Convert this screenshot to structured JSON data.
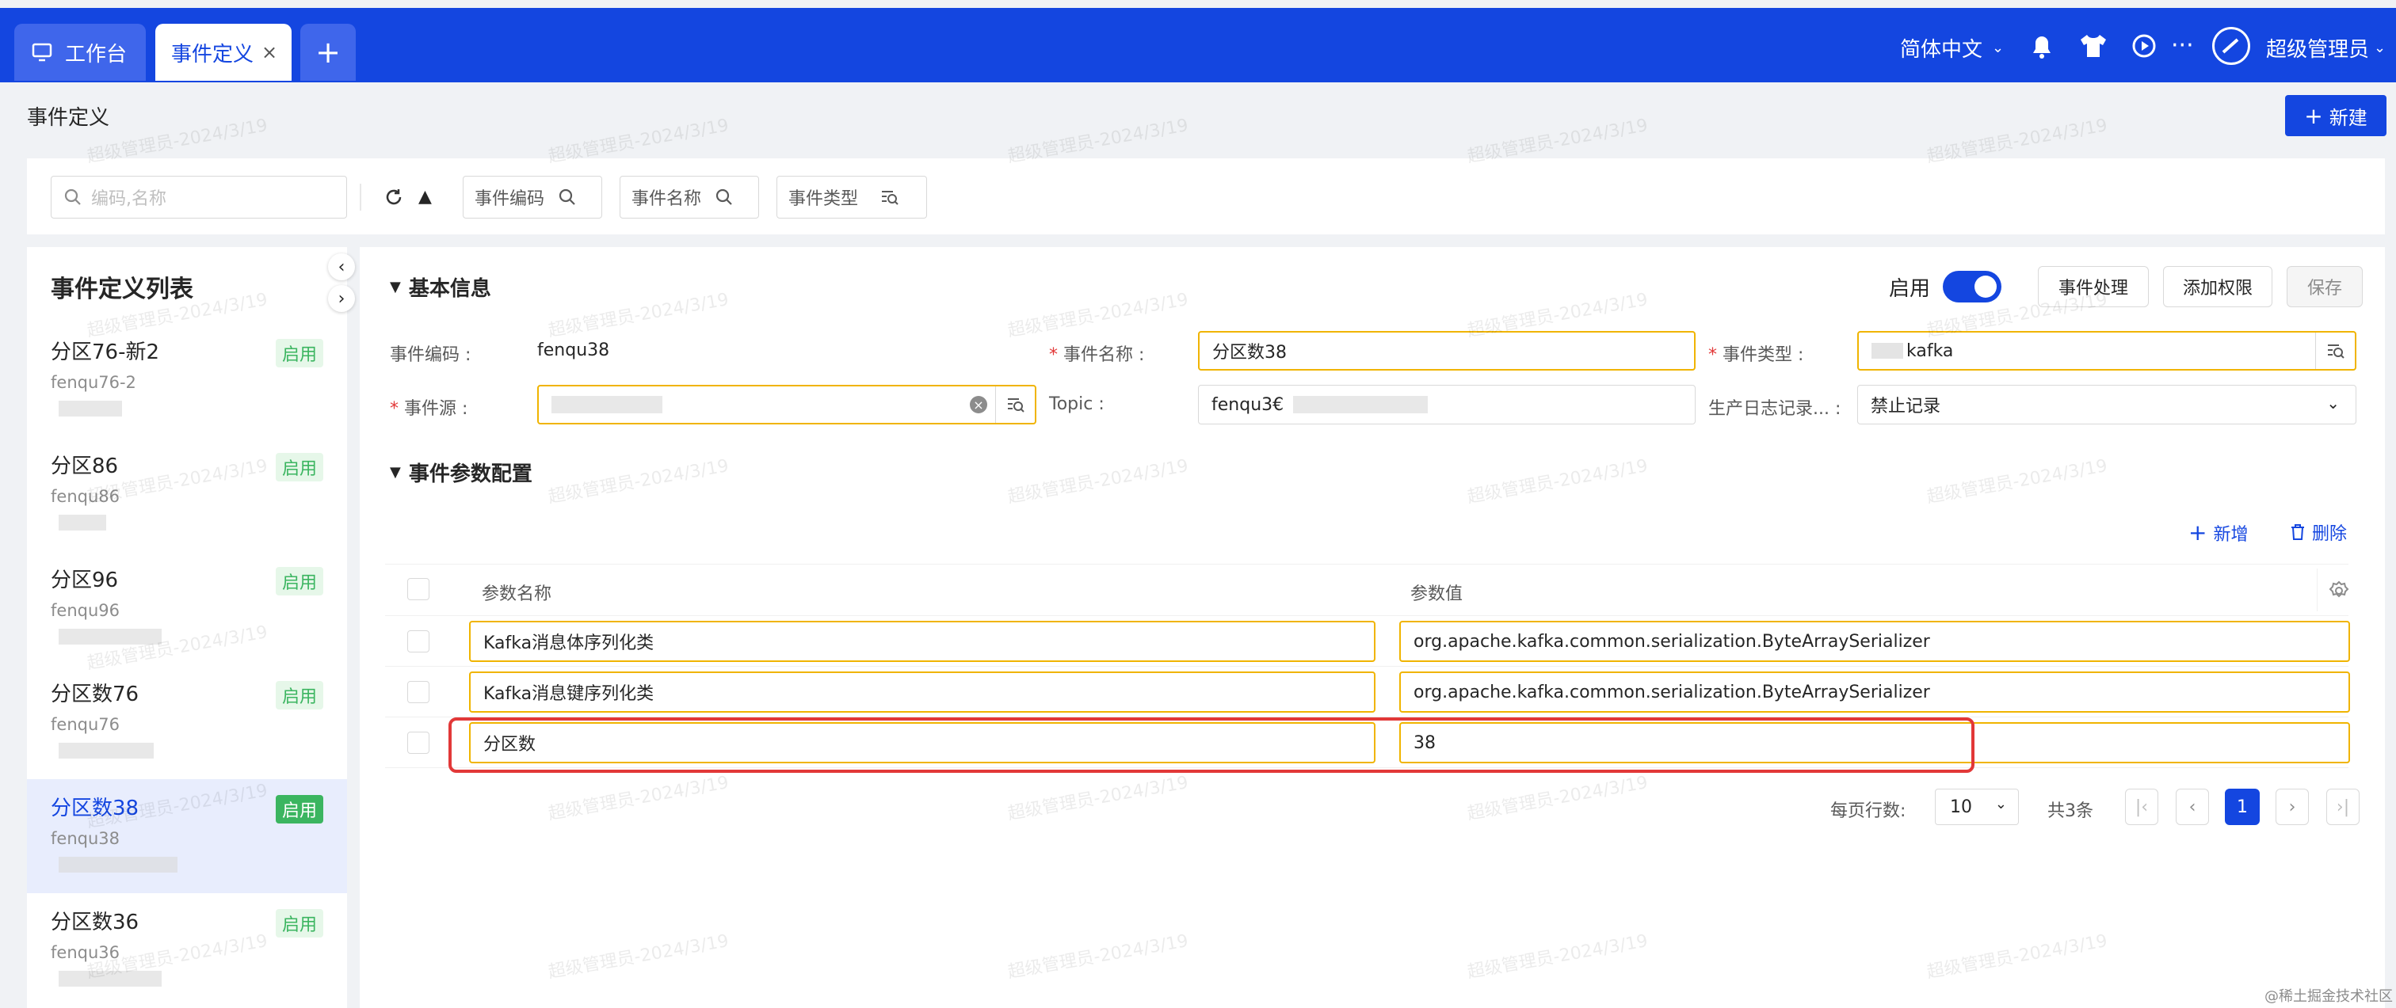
{
  "header": {
    "tabs": [
      {
        "label": "工作台"
      },
      {
        "label": "事件定义"
      }
    ],
    "lang": "简体中文",
    "user": "超级管理员"
  },
  "page": {
    "title": "事件定义",
    "new_button": "新建"
  },
  "filters": {
    "search_placeholder": "编码,名称",
    "chips": [
      "事件编码",
      "事件名称",
      "事件类型"
    ]
  },
  "list": {
    "title": "事件定义列表",
    "items": [
      {
        "title": "分区76-新2",
        "sub": "fenqu76-2",
        "status": "启用"
      },
      {
        "title": "分区86",
        "sub": "fenqu86",
        "status": "启用"
      },
      {
        "title": "分区96",
        "sub": "fenqu96",
        "status": "启用"
      },
      {
        "title": "分区数76",
        "sub": "fenqu76",
        "status": "启用"
      },
      {
        "title": "分区数38",
        "sub": "fenqu38",
        "status": "启用"
      },
      {
        "title": "分区数36",
        "sub": "fenqu36",
        "status": "启用"
      }
    ]
  },
  "basic": {
    "title": "基本信息",
    "enable": "启用",
    "buttons": [
      "事件处理",
      "添加权限",
      "保存"
    ],
    "labels": {
      "code": "事件编码 :",
      "name": "事件名称 :",
      "type": "事件类型 :",
      "source": "事件源 :",
      "topic": "Topic :",
      "log": "生产日志记录... :"
    },
    "values": {
      "code": "fenqu38",
      "name": "分区数38",
      "type": "kafka",
      "topic": "fenqu3€",
      "log": "禁止记录"
    }
  },
  "params": {
    "title": "事件参数配置",
    "add": "新增",
    "delete": "删除",
    "col1": "参数名称",
    "col2": "参数值",
    "rows": [
      {
        "name": "Kafka消息体序列化类",
        "value": "org.apache.kafka.common.serialization.ByteArraySerializer"
      },
      {
        "name": "Kafka消息键序列化类",
        "value": "org.apache.kafka.common.serialization.ByteArraySerializer"
      },
      {
        "name": "分区数",
        "value": "38"
      }
    ]
  },
  "pagination": {
    "per_page_label": "每页行数:",
    "per_page": "10",
    "total": "共3条",
    "current": "1"
  },
  "watermark": "超级管理员-2024/3/19",
  "footer_note": "@稀土掘金技术社区",
  "colors": {
    "brand": "#1446e0",
    "orange": "#f0b400",
    "red": "#e23838",
    "green": "#3bb560"
  }
}
